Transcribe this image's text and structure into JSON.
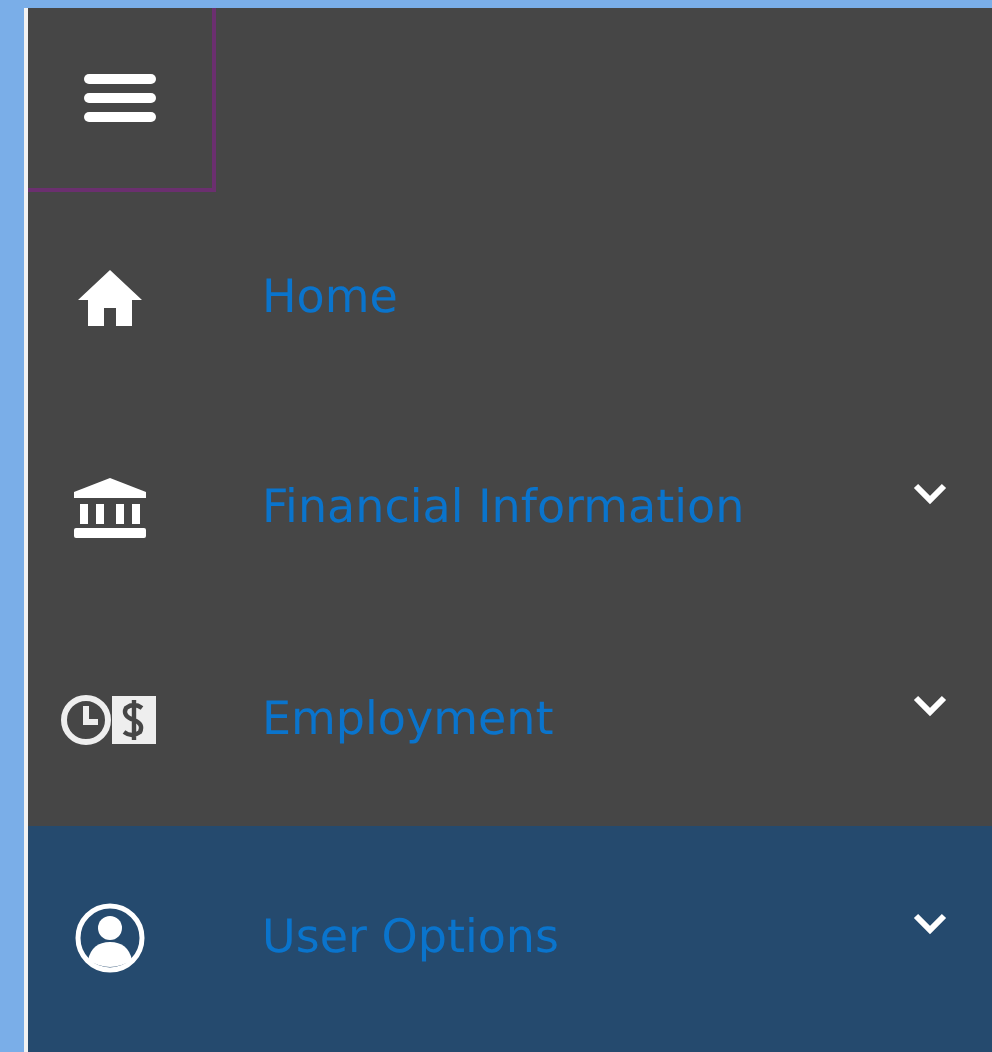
{
  "items": [
    {
      "label": "Home",
      "has_submenu": false,
      "selected": false
    },
    {
      "label": "Financial Information",
      "has_submenu": true,
      "selected": false
    },
    {
      "label": "Employment",
      "has_submenu": true,
      "selected": false
    },
    {
      "label": "User Options",
      "has_submenu": true,
      "selected": true
    }
  ]
}
